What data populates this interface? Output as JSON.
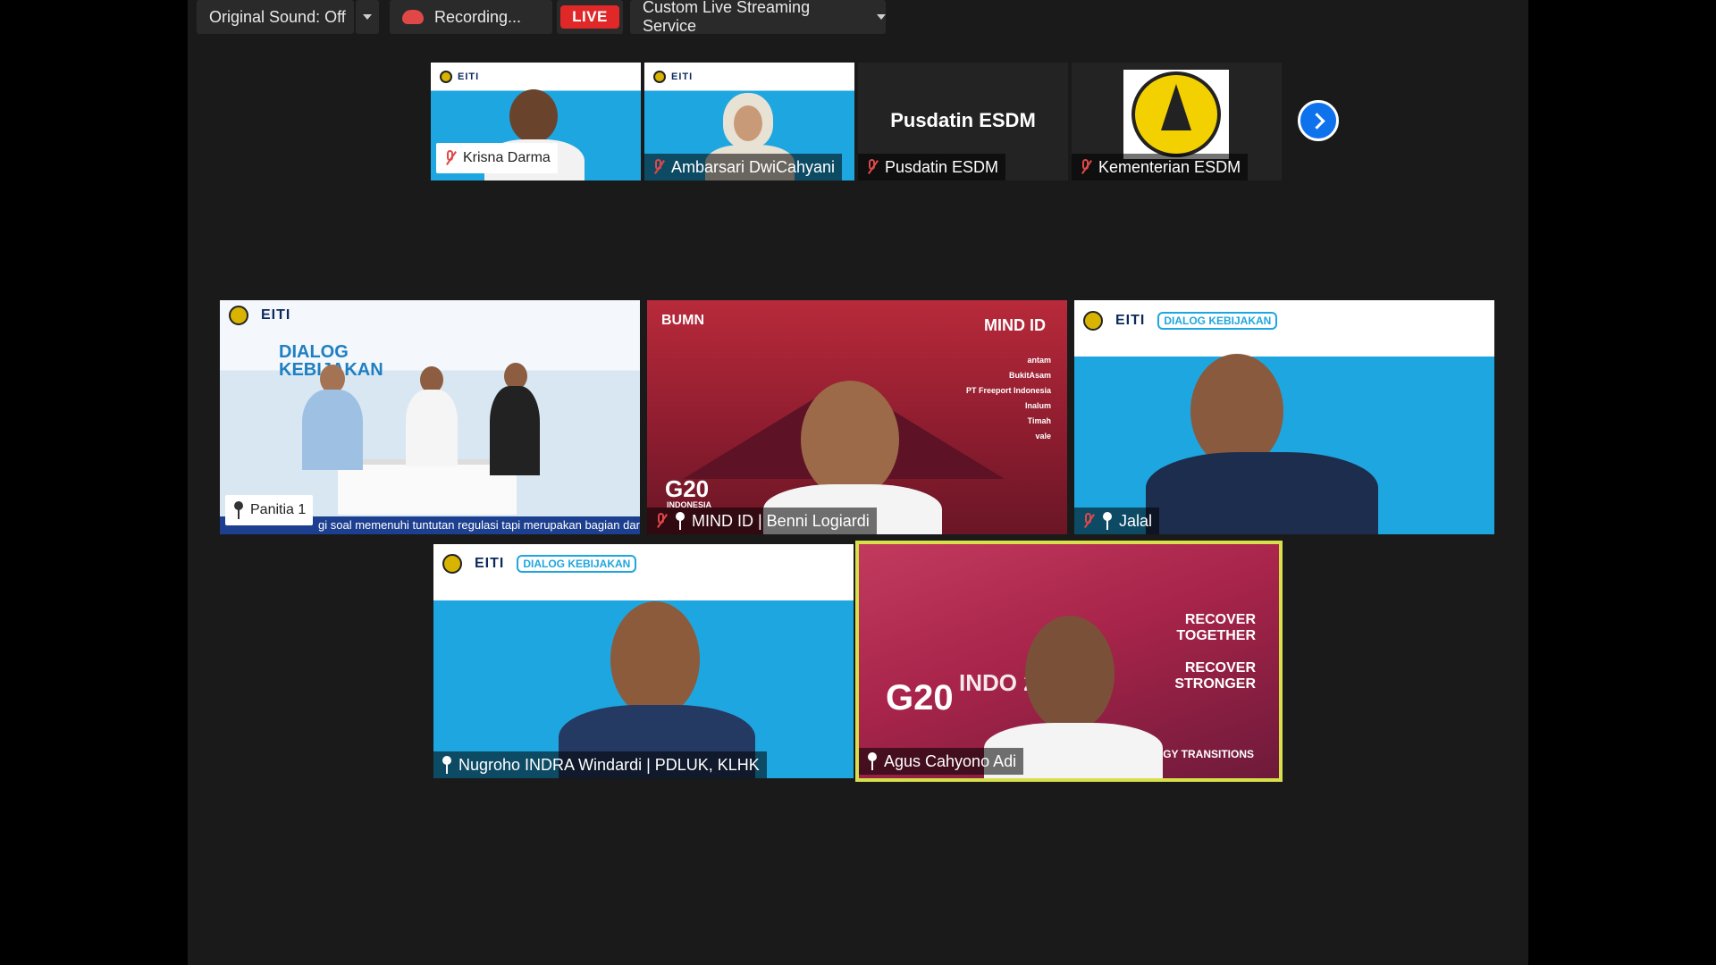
{
  "toolbar": {
    "original_sound": "Original Sound: Off",
    "recording": "Recording...",
    "live": "LIVE",
    "stream_service": "Custom Live Streaming Service"
  },
  "strip": [
    {
      "name": "Krisna Darma",
      "muted": true
    },
    {
      "name": "Ambarsari DwiCahyani",
      "muted": true
    },
    {
      "name": "Pusdatin ESDM",
      "muted": true,
      "display_title": "Pusdatin ESDM"
    },
    {
      "name": "Kementerian ESDM",
      "muted": true
    }
  ],
  "grid": [
    {
      "name": "Panitia 1",
      "ticker": "gi soal memenuhi tuntutan regulasi tapi merupakan bagian dari a"
    },
    {
      "name": "MIND ID | Benni Logiardi",
      "muted": true,
      "pinned": true
    },
    {
      "name": "Jalal",
      "muted": true,
      "pinned": true
    },
    {
      "name": "Nugroho INDRA Windardi | PDLUK, KLHK",
      "pinned": true
    },
    {
      "name": "Agus Cahyono Adi",
      "pinned": true,
      "active_speaker": true
    }
  ],
  "backdrop_text": {
    "eiti": "EITI",
    "indonesia": "INDONESIA",
    "dialog": "DIALOG KEBIJAKAN",
    "bumn": "BUMN",
    "mind_id": "MIND ID",
    "g20": "G20",
    "g20_indonesia": "INDONESIA",
    "g20_year": "INDO 2022",
    "recover_together": "RECOVER TOGETHER",
    "recover_stronger": "RECOVER STRONGER",
    "transitions": "GY TRANSITIONS",
    "brands": [
      "antam",
      "BukitAsam",
      "PT Freeport Indonesia",
      "Inalum",
      "Timah",
      "vale"
    ]
  },
  "colors": {
    "live": "#e02828",
    "active_border": "#d7e04a",
    "next_button": "#0e72ed"
  },
  "icons": {
    "muted": "mic-muted-icon",
    "pinned": "pin-icon",
    "record": "record-cloud-icon",
    "next": "chevron-right-icon"
  }
}
